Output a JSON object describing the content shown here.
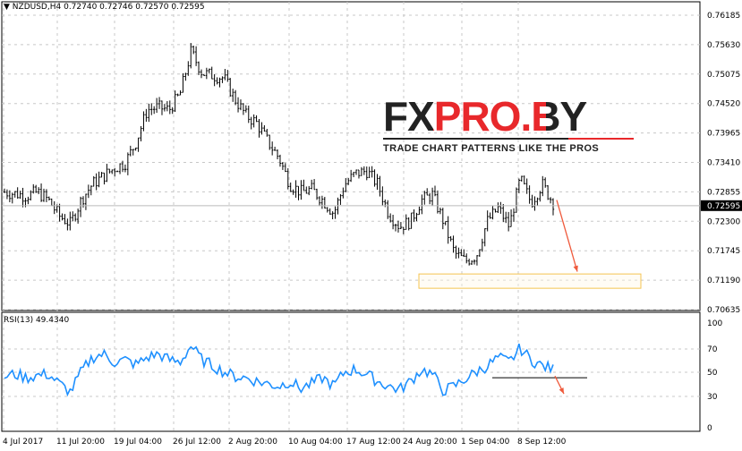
{
  "header": {
    "symbol": "NZDUSD,H4",
    "ohlc": "0.72740 0.72746 0.72570 0.72595"
  },
  "rsi_label": "RSI(13) 49.4340",
  "logo": {
    "brand": "FXPRO.BY",
    "tagline": "TRADE CHART PATTERNS LIKE THE PROS"
  },
  "colors": {
    "candle": "#000000",
    "rsi": "#1e90ff",
    "arrow": "#ef5a3c",
    "zone": "#f5c451",
    "grid": "#c8c8c8"
  },
  "chart_data": [
    {
      "type": "candlestick",
      "title": "NZDUSD,H4",
      "yticks": [
        "0.76185",
        "0.75630",
        "0.75075",
        "0.74520",
        "0.73965",
        "0.73410",
        "0.72855",
        "0.72300",
        "0.71745",
        "0.71190",
        "0.70635"
      ],
      "current_price": "0.72595",
      "ylim": [
        0.70635,
        0.76185
      ],
      "xticks": [
        "4 Jul 2017",
        "11 Jul 20:00",
        "19 Jul 04:00",
        "26 Jul 12:00",
        "2 Aug 20:00",
        "10 Aug 04:00",
        "17 Aug 12:00",
        "24 Aug 20:00",
        "1 Sep 04:00",
        "8 Sep 12:00"
      ],
      "approx_closes": [
        0.7285,
        0.7282,
        0.7278,
        0.7285,
        0.727,
        0.724,
        0.7225,
        0.727,
        0.73,
        0.7315,
        0.733,
        0.734,
        0.738,
        0.744,
        0.7445,
        0.744,
        0.747,
        0.755,
        0.751,
        0.7505,
        0.75,
        0.746,
        0.743,
        0.7415,
        0.738,
        0.735,
        0.73,
        0.7285,
        0.729,
        0.727,
        0.7245,
        0.73,
        0.732,
        0.7325,
        0.73,
        0.7245,
        0.722,
        0.723,
        0.727,
        0.728,
        0.723,
        0.717,
        0.7155,
        0.7165,
        0.723,
        0.7255,
        0.722,
        0.731,
        0.7265,
        0.73,
        0.7265
      ],
      "zone": [
        0.7114,
        0.7124
      ],
      "arrow": {
        "from": 0.727,
        "to": 0.7125
      }
    },
    {
      "type": "line",
      "title": "RSI(13)",
      "yticks": [
        "100",
        "70",
        "50",
        "30",
        "0"
      ],
      "ylim": [
        0,
        100
      ],
      "values": [
        46,
        48,
        45,
        47,
        48,
        40,
        33,
        50,
        62,
        65,
        58,
        60,
        56,
        62,
        65,
        60,
        58,
        72,
        60,
        55,
        50,
        46,
        45,
        42,
        40,
        38,
        42,
        36,
        40,
        45,
        38,
        50,
        52,
        48,
        42,
        38,
        35,
        42,
        52,
        48,
        34,
        38,
        44,
        50,
        55,
        62,
        58,
        70,
        60,
        55,
        52
      ],
      "level": 48,
      "arrow": {
        "from": 48,
        "to": 30
      }
    }
  ]
}
